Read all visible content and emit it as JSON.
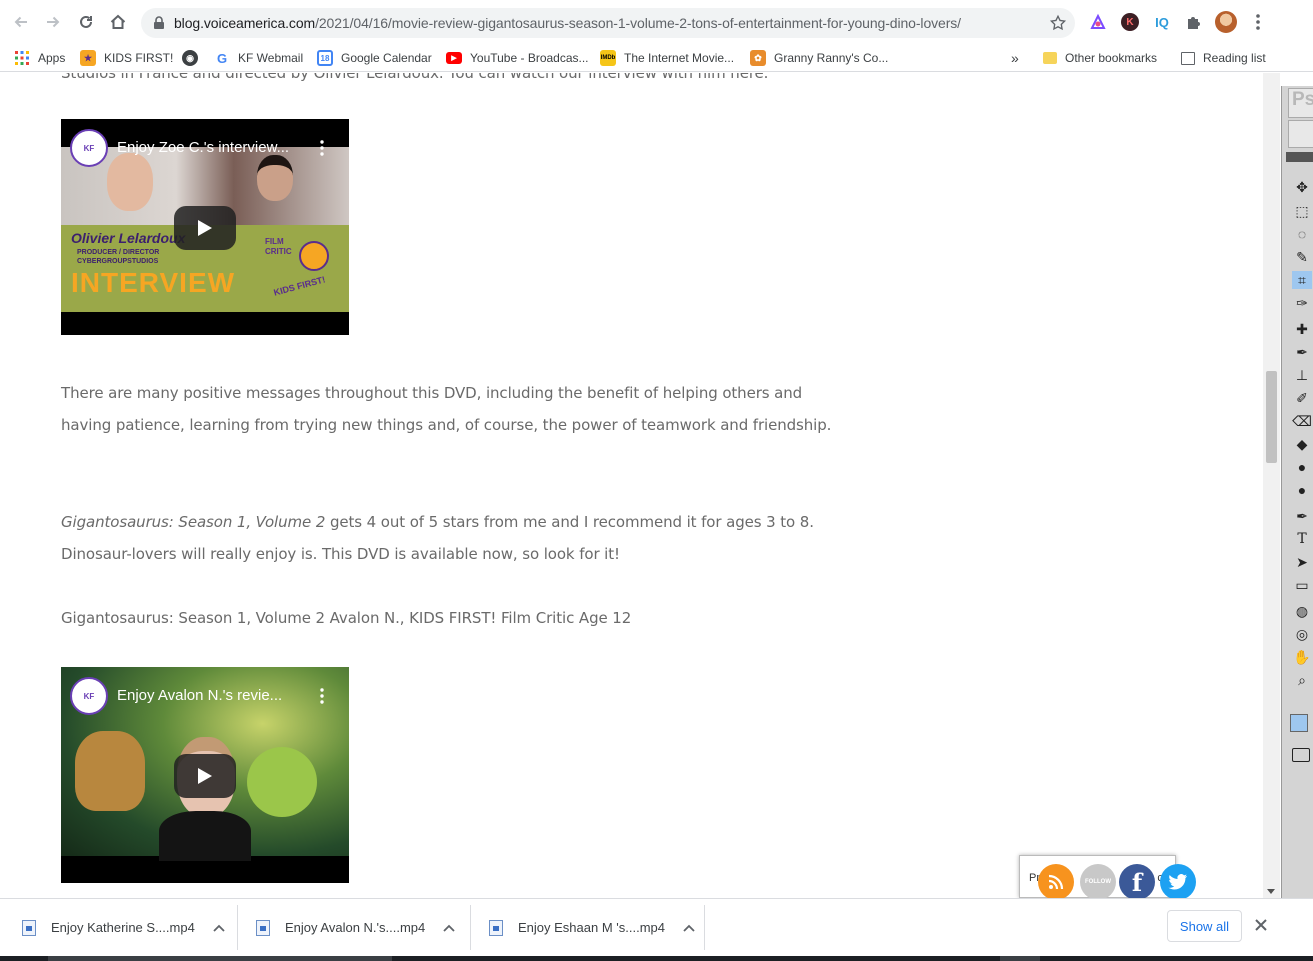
{
  "browser": {
    "url_domain": "blog.voiceamerica.com",
    "url_path": "/2021/04/16/movie-review-gigantosaurus-season-1-volume-2-tons-of-entertainment-for-young-dino-lovers/",
    "extensions": [
      {
        "name": "color-triangle-icon",
        "label": ""
      },
      {
        "name": "k-avatar-icon",
        "label": "K"
      },
      {
        "name": "iq-extension-icon",
        "label": "IQ"
      }
    ]
  },
  "bookmarks": {
    "items": [
      {
        "label": "Apps",
        "icon": "apps-grid-icon"
      },
      {
        "label": "KIDS FIRST!",
        "icon": "kids-first-icon"
      },
      {
        "label": "",
        "icon": "globe-icon"
      },
      {
        "label": "KF Webmail",
        "icon": "google-icon"
      },
      {
        "label": "Google Calendar",
        "icon": "calendar-icon"
      },
      {
        "label": "YouTube - Broadcas...",
        "icon": "youtube-icon"
      },
      {
        "label": "The Internet Movie...",
        "icon": "imdb-icon"
      },
      {
        "label": "Granny Ranny's Co...",
        "icon": "recipe-icon"
      }
    ],
    "overflow": "»",
    "other": "Other bookmarks",
    "reading_list": "Reading list"
  },
  "article": {
    "top_cut_text": "Studios in France and directed by Olivier Lelardoux. You can watch our interview with him here.",
    "video1": {
      "title": "Enjoy Zoe C.'s interview...",
      "thumb_name": "Olivier Lelardoux",
      "thumb_role1": "PRODUCER / DIRECTOR",
      "thumb_role2": "CYBERGROUPSTUDIOS",
      "thumb_big": "INTERVIEW",
      "badge_line1": "FILM",
      "badge_line2": "CRITIC",
      "badge_line3": "KIDS FIRST!"
    },
    "para1_line1": "There are many positive messages throughout this DVD, including the benefit of helping others and",
    "para1_line2": "having patience, learning from trying new things and, of course, the power of teamwork and friendship.",
    "para2_italic": "Gigantosaurus: Season 1, Volume 2",
    "para2_rest": " gets 4 out of 5 stars from me and I recommend it for ages 3 to 8.",
    "para2_line2": "Dinosaur-lovers will really enjoy is. This DVD is available now, so look for it!",
    "byline": "Gigantosaurus: Season 1, Volume 2 Avalon N., KIDS FIRST! Film Critic Age 12",
    "video2": {
      "title": "Enjoy Avalon N.'s revie..."
    }
  },
  "social": {
    "label_start": "Pr",
    "label_mid": "&",
    "label_end": "cy",
    "follow": "FOLLOW"
  },
  "photoshop": {
    "label": "Ps"
  },
  "downloads": {
    "items": [
      {
        "label": "Enjoy Katherine S....mp4"
      },
      {
        "label": "Enjoy Avalon N.'s....mp4"
      },
      {
        "label": "Enjoy Eshaan M 's....mp4"
      }
    ],
    "show_all": "Show all"
  },
  "colors": {
    "accent": "#1a73e8",
    "text": "#6a6a6a",
    "rss": "#f7931e",
    "facebook": "#3b5998",
    "twitter": "#1da1f2"
  }
}
